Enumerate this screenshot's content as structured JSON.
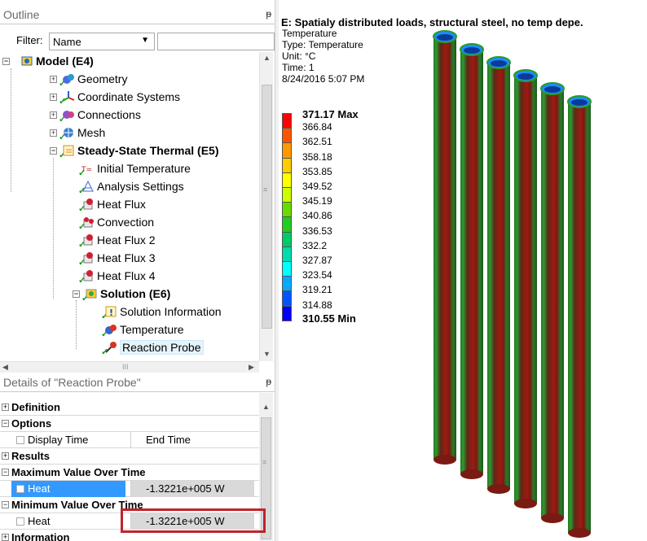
{
  "outline": {
    "title": "Outline",
    "pin": "ᵽ",
    "filter_label": "Filter:",
    "filter_value": "Name",
    "tree": [
      "Model (E4)",
      "Geometry",
      "Coordinate Systems",
      "Connections",
      "Mesh",
      "Steady-State Thermal (E5)",
      "Initial Temperature",
      "Analysis Settings",
      "Heat Flux",
      "Convection",
      "Heat Flux 2",
      "Heat Flux 3",
      "Heat Flux 4",
      "Solution (E6)",
      "Solution Information",
      "Temperature",
      "Reaction Probe"
    ],
    "hscroll_grip": "III"
  },
  "details": {
    "title": "Details of \"Reaction Probe\"",
    "pin": "ᵽ",
    "rows": [
      {
        "type": "cat",
        "label": "Definition",
        "pm": "+"
      },
      {
        "type": "cat",
        "label": "Options",
        "pm": "−"
      },
      {
        "type": "kv",
        "key": "Display Time",
        "value": "End Time"
      },
      {
        "type": "cat",
        "label": "Results",
        "pm": "+"
      },
      {
        "type": "cat",
        "label": "Maximum Value Over Time",
        "pm": "−"
      },
      {
        "type": "kv",
        "key": "Heat",
        "value": "-1.3221e+005 W",
        "highlight": true
      },
      {
        "type": "cat",
        "label": "Minimum Value Over Time",
        "pm": "−"
      },
      {
        "type": "kv",
        "key": "Heat",
        "value": "-1.3221e+005 W"
      },
      {
        "type": "cat",
        "label": "Information",
        "pm": "+"
      }
    ]
  },
  "viewport": {
    "title": "E: Spatialy distributed loads, structural steel, no temp depe.",
    "info": [
      "Temperature",
      "Type: Temperature",
      "Unit: °C",
      "Time: 1",
      "8/24/2016 5:07 PM"
    ],
    "legend": {
      "max_label": "371.17 Max",
      "min_label": "310.55 Min",
      "values": [
        "366.84",
        "362.51",
        "358.18",
        "353.85",
        "349.52",
        "345.19",
        "340.86",
        "336.53",
        "332.2",
        "327.87",
        "323.54",
        "319.21",
        "314.88"
      ],
      "colors": [
        "#ff0000",
        "#ff5500",
        "#ff9900",
        "#ffcc00",
        "#ffff00",
        "#ccff00",
        "#66dd00",
        "#22cc22",
        "#00cc66",
        "#00ddaa",
        "#00ffff",
        "#00aaff",
        "#0055ff",
        "#0000ff"
      ]
    },
    "pipe_count": 6
  }
}
